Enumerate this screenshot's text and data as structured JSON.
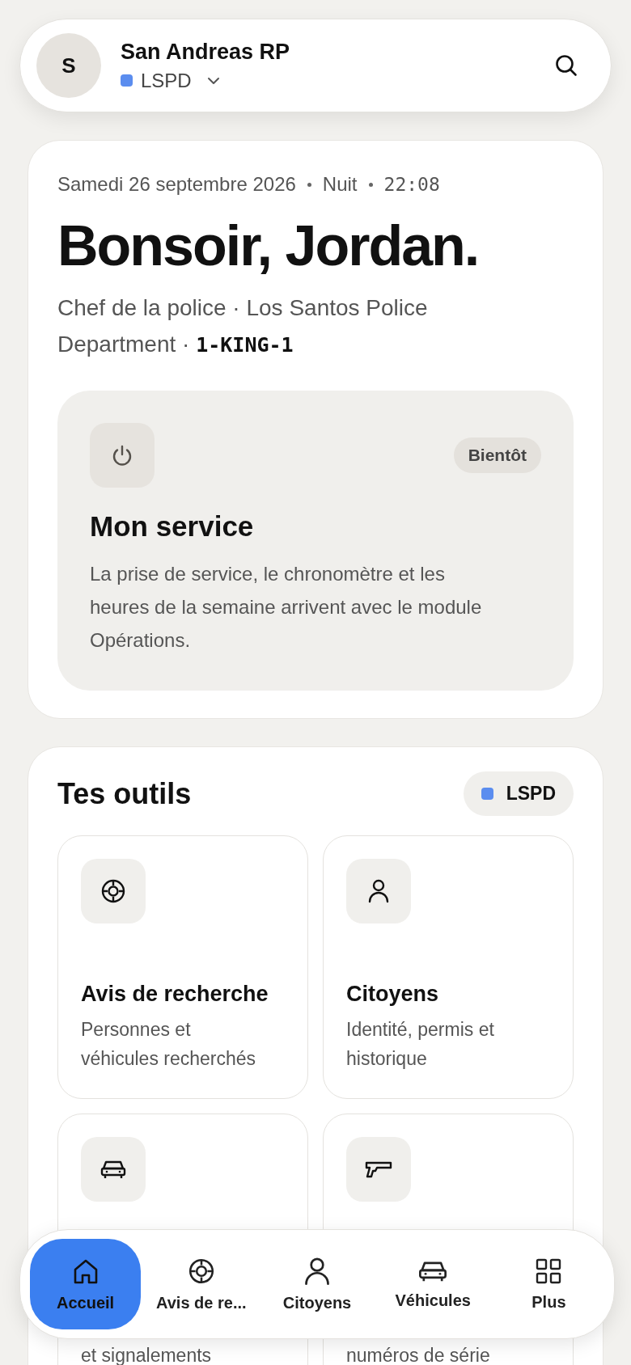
{
  "header": {
    "avatar_initial": "S",
    "title": "San Andreas RP",
    "org": {
      "label": "LSPD",
      "color": "#5b8def"
    }
  },
  "greeting": {
    "date": "Samedi 26 septembre 2026",
    "period": "Nuit",
    "time": "22:08",
    "heading": "Bonsoir, Jordan.",
    "role": "Chef de la police · Los Santos Police Department ·",
    "callsign": "1-KING-1"
  },
  "service": {
    "badge": "Bientôt",
    "title": "Mon service",
    "text": "La prise de service, le chronomètre et les heures de la semaine arrivent avec le module Opérations."
  },
  "tools": {
    "title": "Tes outils",
    "org": {
      "label": "LSPD",
      "color": "#5b8def"
    },
    "items": [
      {
        "title": "Avis de recherche",
        "description": "Personnes et véhicules recherchés"
      },
      {
        "title": "Citoyens",
        "description": "Identité, permis et historique"
      },
      {
        "description": "et signalements"
      },
      {
        "description": "numéros de série"
      }
    ]
  },
  "nav": [
    {
      "label": "Accueil",
      "selected": true
    },
    {
      "label": "Avis de re...",
      "selected": false
    },
    {
      "label": "Citoyens",
      "selected": false
    },
    {
      "label": "Véhicules",
      "selected": false
    },
    {
      "label": "Plus",
      "selected": false
    }
  ]
}
